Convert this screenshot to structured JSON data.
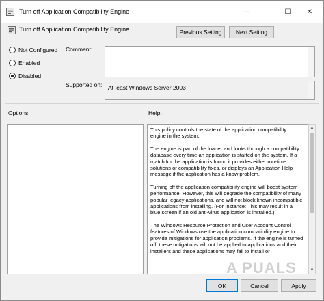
{
  "window": {
    "title": "Turn off Application Compatibility Engine",
    "controls": {
      "minimize": "—",
      "maximize": "☐",
      "close": "✕"
    }
  },
  "header": {
    "title": "Turn off Application Compatibility Engine",
    "previous_label": "Previous Setting",
    "next_label": "Next Setting"
  },
  "state": {
    "options": [
      {
        "label": "Not Configured",
        "selected": false
      },
      {
        "label": "Enabled",
        "selected": false
      },
      {
        "label": "Disabled",
        "selected": true
      }
    ]
  },
  "comment": {
    "label": "Comment:",
    "value": ""
  },
  "supported": {
    "label": "Supported on:",
    "value": "At least Windows Server 2003"
  },
  "options_panel": {
    "label": "Options:"
  },
  "help_panel": {
    "label": "Help:",
    "paragraphs": [
      "This policy controls the state of the application compatibility engine in the system.",
      "The engine is part of the loader and looks through a compatibility database every time an application is started on the system.  If a match for the application is found it provides either run-time solutions or compatibility fixes, or displays an Application Help message if the application has a know problem.",
      "Turning off the application compatibility engine will boost system performance.  However, this will degrade the compatibility of many popular legacy applications, and will not block known incompatible applications from installing.  (For Instance: This may result in a blue screen if an old anti-virus application is installed.)",
      "The Windows Resource Protection and User Account Control features of Windows use the application compatibility engine to provide mitigations for application problems. If the engine is turned off, these mitigations will not be applied to applications and their installers and these applications may fail to install or"
    ]
  },
  "footer": {
    "ok_label": "OK",
    "cancel_label": "Cancel",
    "apply_label": "Apply"
  },
  "watermark": "A PUALS",
  "icons": {
    "policy": "policy-settings-icon"
  }
}
